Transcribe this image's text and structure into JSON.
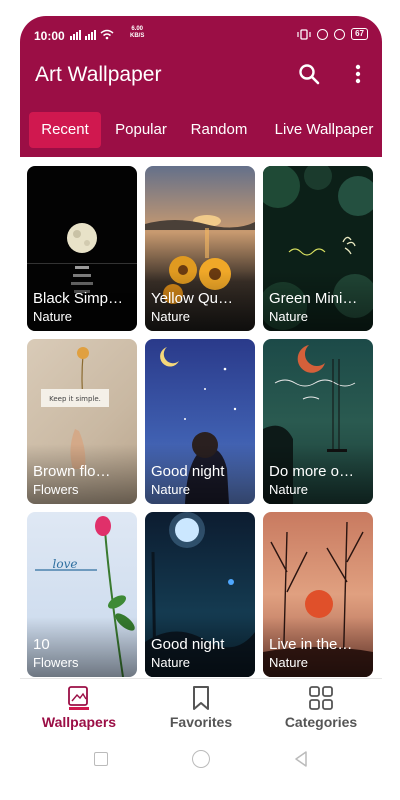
{
  "status_bar": {
    "time": "10:00",
    "speed": "6.00",
    "speed_unit": "KB/S",
    "battery": "67"
  },
  "app_bar": {
    "title": "Art Wallpaper",
    "icons": [
      "search-icon",
      "more-vert-icon"
    ]
  },
  "tabs": [
    {
      "label": "Recent",
      "active": true
    },
    {
      "label": "Popular",
      "active": false
    },
    {
      "label": "Random",
      "active": false
    },
    {
      "label": "Live Wallpaper",
      "active": false
    }
  ],
  "wallpapers": [
    {
      "title": "Black Simp…",
      "category": "Nature"
    },
    {
      "title": "Yellow Qu…",
      "category": "Nature"
    },
    {
      "title": "Green Mini…",
      "category": "Nature"
    },
    {
      "title": "Brown flo…",
      "category": "Flowers"
    },
    {
      "title": "Good night",
      "category": "Nature"
    },
    {
      "title": "Do more o…",
      "category": "Nature"
    },
    {
      "title": "10",
      "category": "Flowers"
    },
    {
      "title": "Good night",
      "category": "Nature"
    },
    {
      "title": "Live in the…",
      "category": "Nature"
    }
  ],
  "bottom_nav": [
    {
      "label": "Wallpapers",
      "active": true,
      "icon": "wallpaper-icon"
    },
    {
      "label": "Favorites",
      "active": false,
      "icon": "bookmark-icon"
    },
    {
      "label": "Categories",
      "active": false,
      "icon": "grid-icon"
    }
  ],
  "colors": {
    "primary": "#9b0e45",
    "tab_active": "#d0184f"
  }
}
